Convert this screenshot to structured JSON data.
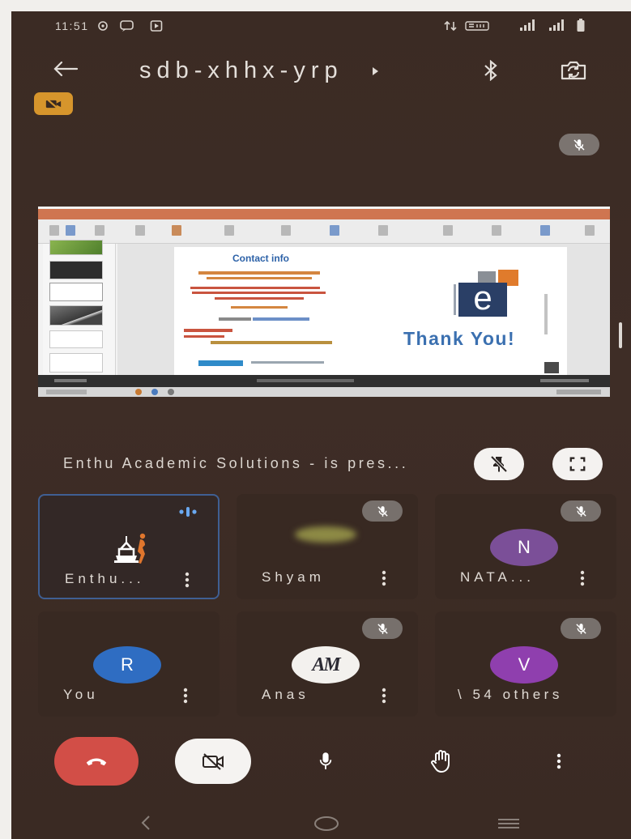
{
  "status_bar": {
    "time": "11:51",
    "left_icons": [
      "circle-notification-icon",
      "chat-bubble-icon",
      "media-notification-icon"
    ],
    "right_icons": [
      "data-transfer-icon",
      "volte-icon",
      "signal-icon",
      "signal-icon",
      "battery-icon"
    ]
  },
  "header": {
    "meeting_code": "sdb-xhhx-yrp",
    "back_icon": "back-arrow-icon",
    "chevron_icon": "chevron-right-icon",
    "bluetooth_icon": "bluetooth-icon",
    "switch_camera_icon": "switch-camera-icon"
  },
  "self_view_badge": {
    "icon": "camera-off-icon",
    "color": "#d6952c"
  },
  "self_mic_badge": {
    "icon": "mic-off-icon"
  },
  "presentation": {
    "slide": {
      "title": "Contact info",
      "logo_letter": "e",
      "closing_text": "Thank You!"
    }
  },
  "presenter_bar": {
    "text": "Enthu Academic Solutions - is pres...",
    "pin_icon": "unpin-icon",
    "fullscreen_icon": "fullscreen-icon"
  },
  "participants": [
    {
      "name": "Enthu...",
      "avatar_icon": "enthu-logo-icon",
      "speaking": true,
      "muted": false
    },
    {
      "name": "Shyam",
      "has_video": true,
      "muted": true
    },
    {
      "name": "NATA...",
      "initial": "N",
      "avatar_color": "#7b4f98",
      "muted": true
    },
    {
      "name": "You",
      "initial": "R",
      "avatar_color": "#2f6dc2",
      "muted": false
    },
    {
      "name": "Anas",
      "initial": "AM",
      "avatar_color": "#f3f1ee",
      "muted": true
    },
    {
      "name": "\\ 54 others",
      "initial": "V",
      "avatar_color": "#8f3fae",
      "muted": true
    }
  ],
  "controls": {
    "end_call_icon": "phone-hangup-icon",
    "camera_icon": "camera-off-icon",
    "mic_icon": "mic-icon",
    "raise_hand_icon": "raise-hand-icon",
    "more_icon": "more-vertical-icon"
  },
  "navigation_bar": {
    "back_icon": "nav-back-icon",
    "home_icon": "nav-home-icon",
    "recents_icon": "nav-recents-icon"
  },
  "colors": {
    "background": "#3d2c25",
    "end_call": "#d24e47",
    "active_border": "#3f5f93",
    "speaking_indicator": "#6aa8f0",
    "muted_pill": "#77706c"
  }
}
